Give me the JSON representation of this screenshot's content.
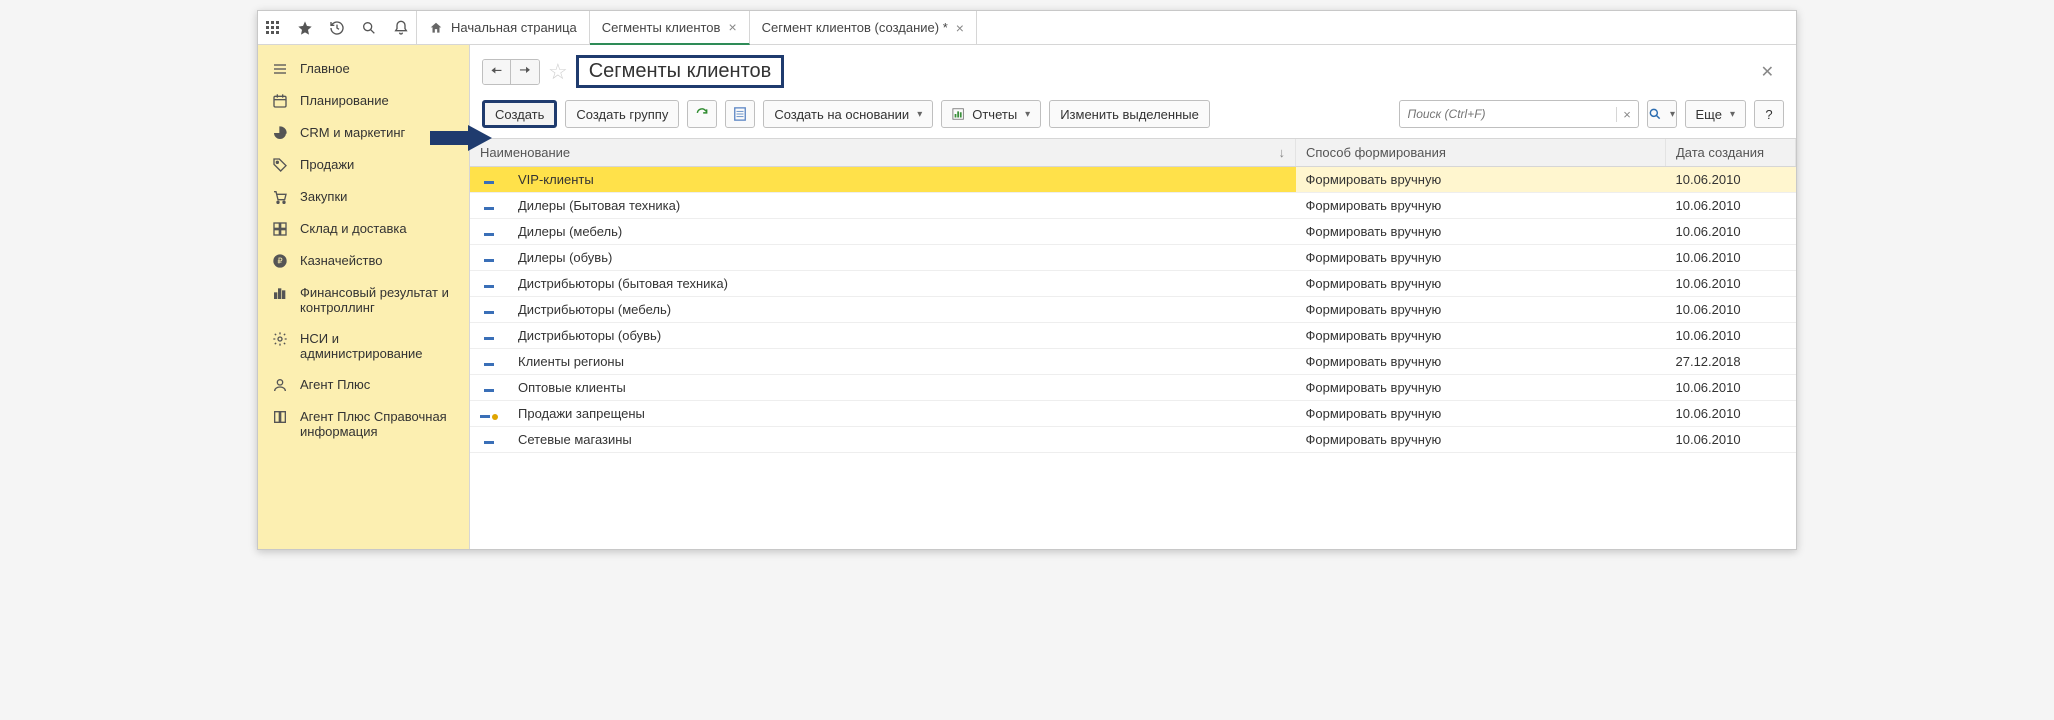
{
  "topbar": {
    "tabs": [
      {
        "label": "Начальная страница",
        "home": true,
        "closable": false,
        "active": false
      },
      {
        "label": "Сегменты клиентов",
        "closable": true,
        "active": true
      },
      {
        "label": "Сегмент клиентов (создание) *",
        "closable": true,
        "active": false
      }
    ]
  },
  "sidebar": {
    "items": [
      {
        "icon": "menu",
        "label": "Главное"
      },
      {
        "icon": "calendar",
        "label": "Планирование"
      },
      {
        "icon": "pie",
        "label": "CRM и маркетинг"
      },
      {
        "icon": "tag",
        "label": "Продажи"
      },
      {
        "icon": "cart",
        "label": "Закупки"
      },
      {
        "icon": "boxes",
        "label": "Склад и доставка"
      },
      {
        "icon": "ruble",
        "label": "Казначейство"
      },
      {
        "icon": "bars",
        "label": "Финансовый результат и контроллинг"
      },
      {
        "icon": "gear",
        "label": "НСИ и администрирование"
      },
      {
        "icon": "agent",
        "label": "Агент Плюс"
      },
      {
        "icon": "book",
        "label": "Агент Плюс Справочная информация"
      }
    ]
  },
  "page": {
    "title": "Сегменты клиентов"
  },
  "toolbar": {
    "create": "Создать",
    "create_group": "Создать группу",
    "create_based_on": "Создать на основании",
    "reports": "Отчеты",
    "change_selected": "Изменить выделенные",
    "search_placeholder": "Поиск (Ctrl+F)",
    "more": "Еще",
    "help": "?"
  },
  "table": {
    "columns": {
      "name": "Наименование",
      "method": "Способ формирования",
      "date": "Дата создания"
    },
    "rows": [
      {
        "name": "VIP-клиенты",
        "method": "Формировать вручную",
        "date": "10.06.2010",
        "selected": true
      },
      {
        "name": "Дилеры (Бытовая техника)",
        "method": "Формировать вручную",
        "date": "10.06.2010"
      },
      {
        "name": "Дилеры (мебель)",
        "method": "Формировать вручную",
        "date": "10.06.2010"
      },
      {
        "name": "Дилеры (обувь)",
        "method": "Формировать вручную",
        "date": "10.06.2010"
      },
      {
        "name": "Дистрибьюторы (бытовая техника)",
        "method": "Формировать вручную",
        "date": "10.06.2010"
      },
      {
        "name": "Дистрибьюторы (мебель)",
        "method": "Формировать вручную",
        "date": "10.06.2010"
      },
      {
        "name": "Дистрибьюторы (обувь)",
        "method": "Формировать вручную",
        "date": "10.06.2010"
      },
      {
        "name": "Клиенты регионы",
        "method": "Формировать вручную",
        "date": "27.12.2018"
      },
      {
        "name": "Оптовые клиенты",
        "method": "Формировать вручную",
        "date": "10.06.2010"
      },
      {
        "name": "Продажи запрещены",
        "method": "Формировать вручную",
        "date": "10.06.2010",
        "blocked": true
      },
      {
        "name": "Сетевые магазины",
        "method": "Формировать вручную",
        "date": "10.06.2010"
      }
    ]
  }
}
